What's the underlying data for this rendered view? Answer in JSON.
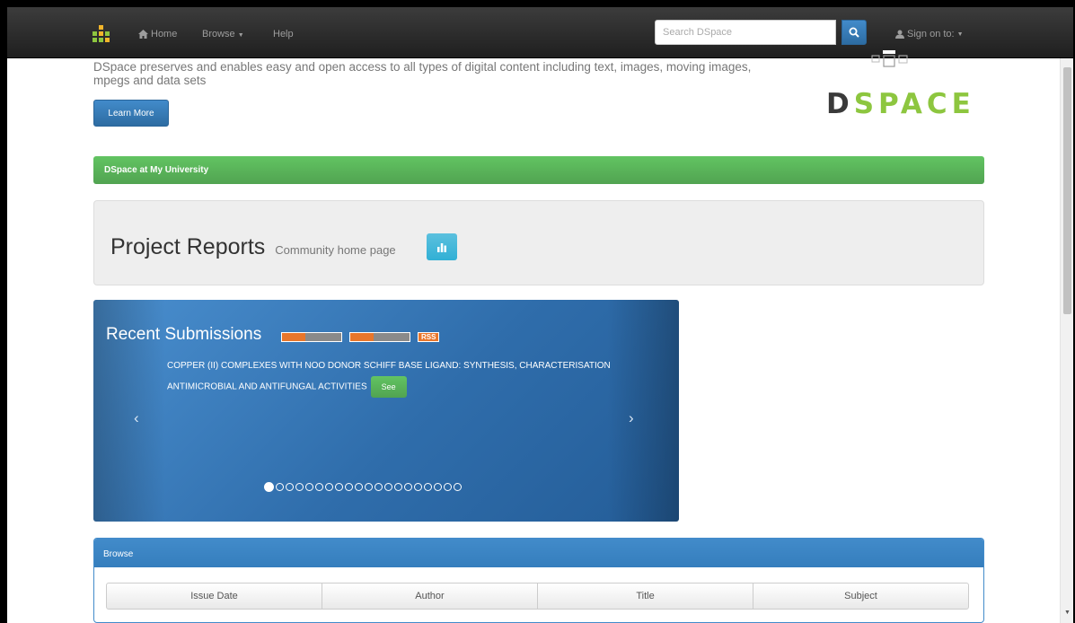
{
  "navbar": {
    "home_label": "Home",
    "browse_label": "Browse",
    "help_label": "Help",
    "search_placeholder": "Search DSpace",
    "sign_on_label": "Sign on to:"
  },
  "hero": {
    "description": "DSpace preserves and enables easy and open access to all types of digital content including text, images, moving images, mpegs and data sets",
    "learn_more_label": "Learn More",
    "logo_text_first": "D",
    "logo_text_rest": "SPACE"
  },
  "site_bar": {
    "label": "DSpace at My University"
  },
  "community": {
    "title": "Project Reports",
    "subtitle": "Community home page"
  },
  "recent_submissions": {
    "title_first": "Recent",
    "title_second": "Submissions",
    "rss_label": "RSS",
    "item_title": "COPPER (II) COMPLEXES WITH NOO DONOR SCHIFF BASE LIGAND: SYNTHESIS, CHARACTERISATION ANTIMICROBIAL AND ANTIFUNGAL ACTIVITIES",
    "see_label": "See",
    "prev_glyph": "‹",
    "next_glyph": "›",
    "slide_count": 20,
    "active_slide": 1
  },
  "browse": {
    "heading": "Browse",
    "buttons": [
      "Issue Date",
      "Author",
      "Title",
      "Subject"
    ]
  },
  "colors": {
    "primary": "#428bca",
    "success": "#5cb85c",
    "info": "#5bc0de",
    "logo_green": "#8dc63f",
    "navbar": "#222222"
  }
}
